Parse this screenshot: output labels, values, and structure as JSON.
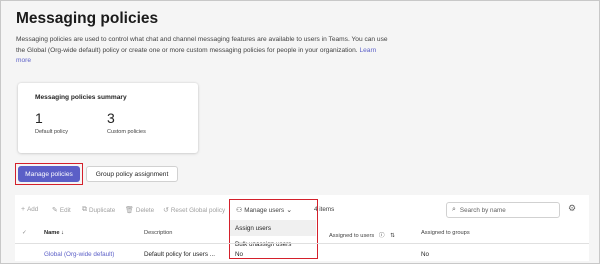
{
  "page": {
    "title": "Messaging policies",
    "description": "Messaging policies are used to control what chat and channel messaging features are available to users in Teams. You can use the Global (Org-wide default) policy or create one or more custom messaging policies for people in your organization.",
    "learn_more": "Learn more"
  },
  "summary": {
    "title": "Messaging policies summary",
    "default_count": "1",
    "default_label": "Default policy",
    "custom_count": "3",
    "custom_label": "Custom policies"
  },
  "tabs": {
    "manage": "Manage policies",
    "group": "Group policy assignment"
  },
  "toolbar": {
    "add": "Add",
    "edit": "Edit",
    "duplicate": "Duplicate",
    "delete": "Delete",
    "reset": "Reset Global policy",
    "manage_users": "Manage users",
    "count": "4 items",
    "search_placeholder": "Search by name"
  },
  "menu": {
    "items": [
      "Assign users",
      "Bulk unassign users"
    ]
  },
  "table": {
    "columns": {
      "name": "Name",
      "description": "Description",
      "assigned_users": "Assigned to users",
      "assigned_groups": "Assigned to groups"
    },
    "rows": [
      {
        "name": "Global (Org-wide default)",
        "description": "Default policy for users ...",
        "custom": "No",
        "groups": "No"
      }
    ]
  }
}
